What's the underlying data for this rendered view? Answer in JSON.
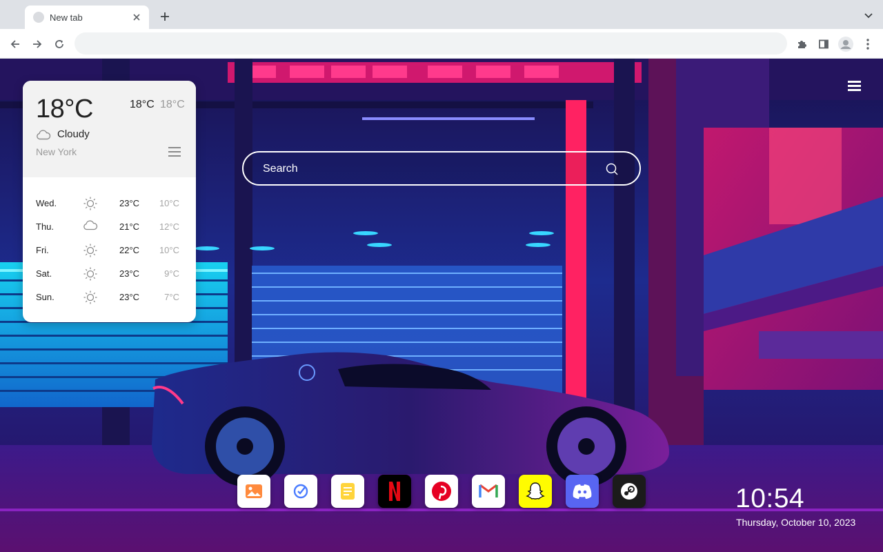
{
  "browser": {
    "tab_title": "New tab",
    "omnibox_value": ""
  },
  "weather": {
    "current_temp": "18°C",
    "high": "18°C",
    "low": "18°C",
    "condition": "Cloudy",
    "condition_icon": "cloud-icon",
    "city": "New York",
    "forecast": [
      {
        "day": "Wed.",
        "icon": "sun-icon",
        "high": "23°C",
        "low": "10°C"
      },
      {
        "day": "Thu.",
        "icon": "cloud-icon",
        "high": "21°C",
        "low": "12°C"
      },
      {
        "day": "Fri.",
        "icon": "sun-icon",
        "high": "22°C",
        "low": "10°C"
      },
      {
        "day": "Sat.",
        "icon": "sun-icon",
        "high": "23°C",
        "low": "9°C"
      },
      {
        "day": "Sun.",
        "icon": "sun-icon",
        "high": "23°C",
        "low": "7°C"
      }
    ]
  },
  "search": {
    "placeholder": "Search"
  },
  "dock": {
    "apps": [
      {
        "name": "Photos",
        "icon": "photos-icon",
        "color": "#ffffff"
      },
      {
        "name": "Tasks",
        "icon": "tasks-icon",
        "color": "#ffffff"
      },
      {
        "name": "Notes",
        "icon": "notes-icon",
        "color": "#ffffff"
      },
      {
        "name": "Netflix",
        "icon": "netflix-icon",
        "color": "#000000"
      },
      {
        "name": "Pinterest",
        "icon": "pinterest-icon",
        "color": "#ffffff"
      },
      {
        "name": "Gmail",
        "icon": "gmail-icon",
        "color": "#ffffff"
      },
      {
        "name": "Snapchat",
        "icon": "snapchat-icon",
        "color": "#fffc00"
      },
      {
        "name": "Discord",
        "icon": "discord-icon",
        "color": "#5865f2"
      },
      {
        "name": "Steam",
        "icon": "steam-icon",
        "color": "#1b1b1b"
      }
    ]
  },
  "clock": {
    "time": "10:54",
    "date": "Thursday, October 10, 2023"
  }
}
